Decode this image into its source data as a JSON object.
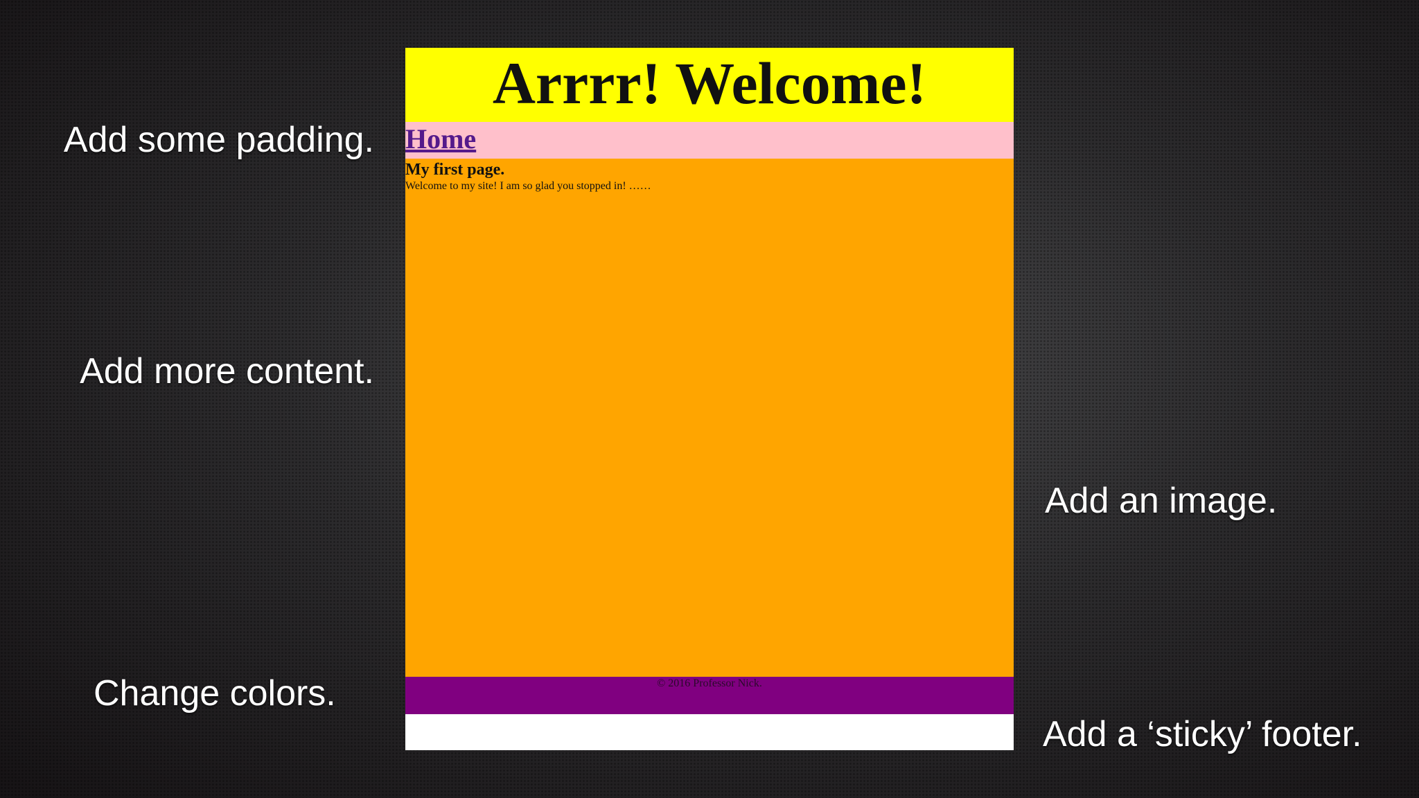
{
  "captions": {
    "padding": "Add some padding.",
    "content": "Add more content.",
    "colors": "Change colors.",
    "image": "Add an image.",
    "footer": "Add a ‘sticky’ footer."
  },
  "demo": {
    "header_title": "Arrrr! Welcome!",
    "nav_link": "Home",
    "main_heading": "My first page.",
    "main_text": "Welcome to my site! I am so glad you stopped in! ……",
    "footer_text": "© 2016 Professor Nick.",
    "colors": {
      "header": "#ffff00",
      "nav": "#ffc0cb",
      "main": "#ffa500",
      "footer": "#800080",
      "link": "#551a8b"
    }
  }
}
